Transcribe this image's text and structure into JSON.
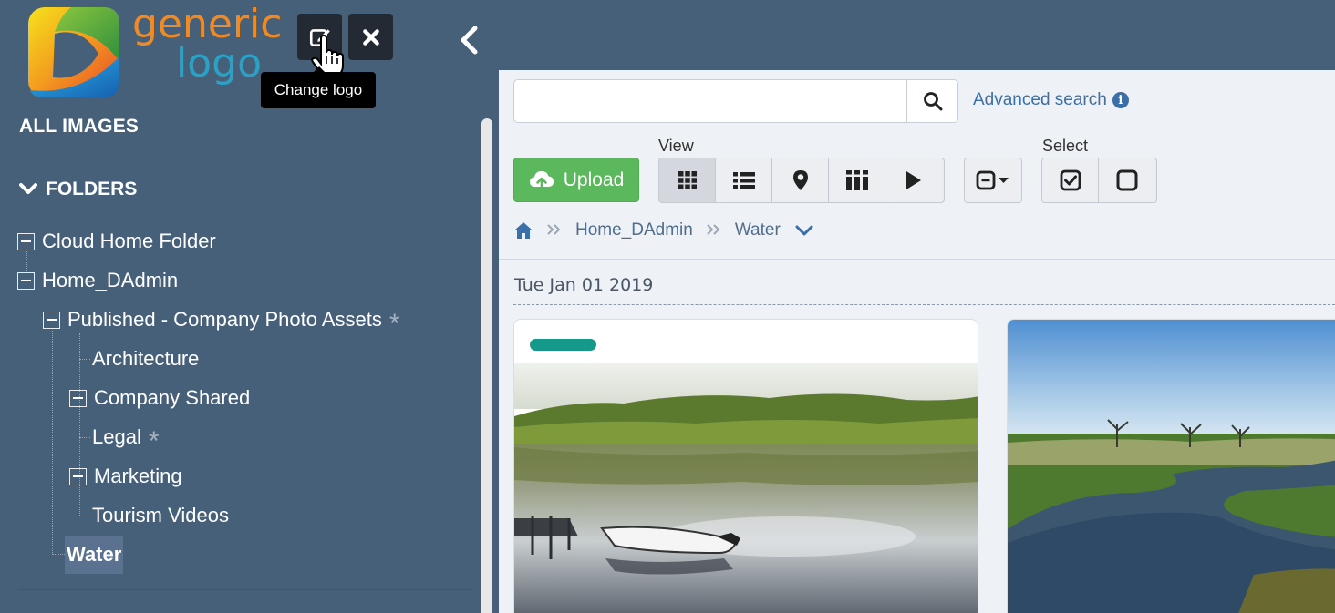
{
  "logo": {
    "line1": "generic",
    "line2": "logo"
  },
  "tooltip": "Change logo",
  "sidebar": {
    "all_images": "ALL IMAGES",
    "folders_label": "FOLDERS",
    "tree": [
      {
        "label": "Cloud Home Folder",
        "toggle": "plus"
      },
      {
        "label": "Home_DAdmin",
        "toggle": "minus"
      },
      {
        "label": "Published - Company Photo Assets",
        "toggle": "minus",
        "starred": true
      },
      {
        "label": "Architecture"
      },
      {
        "label": "Company Shared",
        "toggle": "plus"
      },
      {
        "label": "Legal",
        "starred": true
      },
      {
        "label": "Marketing",
        "toggle": "plus"
      },
      {
        "label": "Tourism Videos"
      },
      {
        "label": "Water",
        "selected": true
      }
    ],
    "star_glyph": "*"
  },
  "search": {
    "placeholder": "",
    "value": "",
    "advanced_label": "Advanced search"
  },
  "toolbar": {
    "upload_label": "Upload",
    "view_label": "View",
    "select_label": "Select",
    "view_modes": [
      "grid-view-icon",
      "list-view-icon",
      "map-pin-icon",
      "columns-view-icon",
      "slideshow-play-icon"
    ]
  },
  "breadcrumb": {
    "items": [
      "Home_DAdmin",
      "Water"
    ]
  },
  "date_group": "Tue Jan 01 2019",
  "colors": {
    "sidebar_bg": "#47607a",
    "accent": "#3a6fa8",
    "upload_green": "#5cb85c",
    "tag_teal": "#14998a"
  }
}
